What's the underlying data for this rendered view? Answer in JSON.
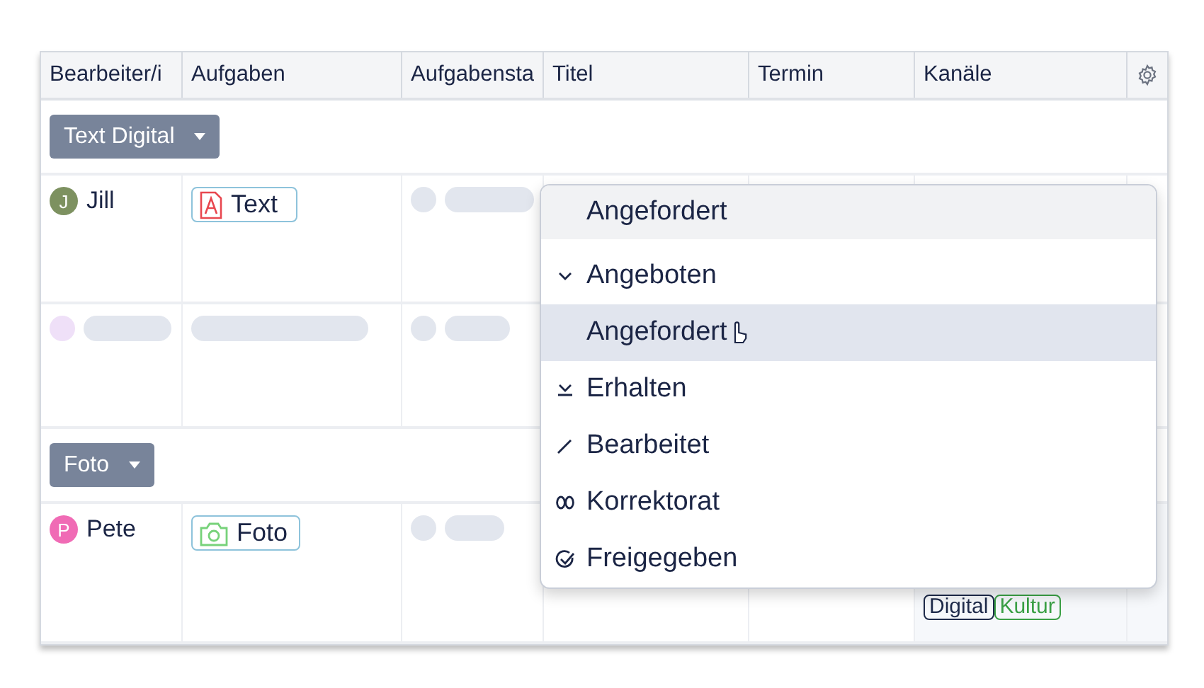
{
  "table": {
    "columns": [
      "Bearbeiter/i",
      "Aufgaben",
      "Aufgabensta",
      "Titel",
      "Termin",
      "Kanäle"
    ],
    "rows": [
      {
        "kind": "group",
        "label": "Text Digital"
      },
      {
        "kind": "person",
        "initial": "J",
        "name": "Jill",
        "color": "#7d9160",
        "task": {
          "kind": "text",
          "label": "Text"
        }
      },
      {
        "kind": "skeleton"
      },
      {
        "kind": "group",
        "label": "Foto"
      },
      {
        "kind": "person",
        "initial": "P",
        "name": "Pete",
        "color": "#f06bb5",
        "task": {
          "kind": "photo",
          "label": "Foto"
        },
        "channels": [
          {
            "label": "Digital",
            "color": "#1e2a4a"
          },
          {
            "label": "Kultur",
            "color": "#3aa045"
          }
        ]
      }
    ]
  },
  "dropdown": {
    "current": "Angefordert",
    "items": [
      {
        "kind": "chevron",
        "label": "Angeboten",
        "selected": false
      },
      {
        "kind": "none",
        "label": "Angefordert",
        "selected": true
      },
      {
        "kind": "tray",
        "label": "Erhalten",
        "selected": false
      },
      {
        "kind": "pencil",
        "label": "Bearbeitet",
        "selected": false
      },
      {
        "kind": "glasses",
        "label": "Korrektorat",
        "selected": false
      },
      {
        "kind": "check",
        "label": "Freigegeben",
        "selected": false
      }
    ]
  }
}
